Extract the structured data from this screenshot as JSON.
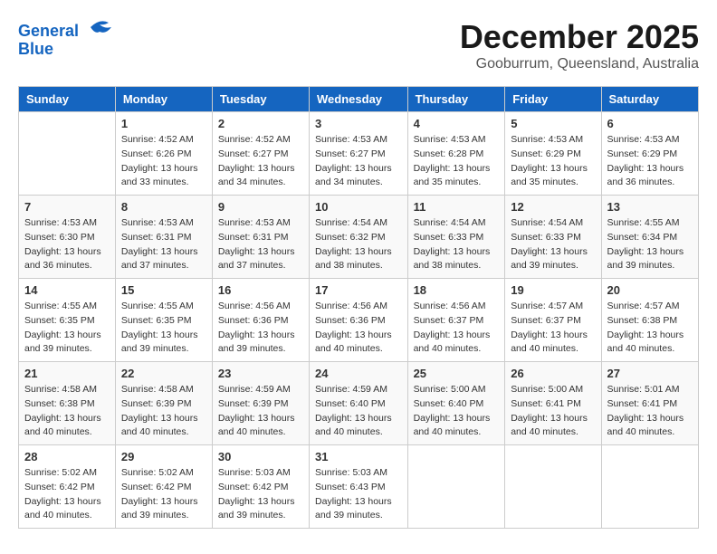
{
  "header": {
    "logo_line1": "General",
    "logo_line2": "Blue",
    "month": "December 2025",
    "location": "Gooburrum, Queensland, Australia"
  },
  "days_of_week": [
    "Sunday",
    "Monday",
    "Tuesday",
    "Wednesday",
    "Thursday",
    "Friday",
    "Saturday"
  ],
  "weeks": [
    [
      {
        "day": "",
        "sunrise": "",
        "sunset": "",
        "daylight": ""
      },
      {
        "day": "1",
        "sunrise": "Sunrise: 4:52 AM",
        "sunset": "Sunset: 6:26 PM",
        "daylight": "Daylight: 13 hours and 33 minutes."
      },
      {
        "day": "2",
        "sunrise": "Sunrise: 4:52 AM",
        "sunset": "Sunset: 6:27 PM",
        "daylight": "Daylight: 13 hours and 34 minutes."
      },
      {
        "day": "3",
        "sunrise": "Sunrise: 4:53 AM",
        "sunset": "Sunset: 6:27 PM",
        "daylight": "Daylight: 13 hours and 34 minutes."
      },
      {
        "day": "4",
        "sunrise": "Sunrise: 4:53 AM",
        "sunset": "Sunset: 6:28 PM",
        "daylight": "Daylight: 13 hours and 35 minutes."
      },
      {
        "day": "5",
        "sunrise": "Sunrise: 4:53 AM",
        "sunset": "Sunset: 6:29 PM",
        "daylight": "Daylight: 13 hours and 35 minutes."
      },
      {
        "day": "6",
        "sunrise": "Sunrise: 4:53 AM",
        "sunset": "Sunset: 6:29 PM",
        "daylight": "Daylight: 13 hours and 36 minutes."
      }
    ],
    [
      {
        "day": "7",
        "sunrise": "Sunrise: 4:53 AM",
        "sunset": "Sunset: 6:30 PM",
        "daylight": "Daylight: 13 hours and 36 minutes."
      },
      {
        "day": "8",
        "sunrise": "Sunrise: 4:53 AM",
        "sunset": "Sunset: 6:31 PM",
        "daylight": "Daylight: 13 hours and 37 minutes."
      },
      {
        "day": "9",
        "sunrise": "Sunrise: 4:53 AM",
        "sunset": "Sunset: 6:31 PM",
        "daylight": "Daylight: 13 hours and 37 minutes."
      },
      {
        "day": "10",
        "sunrise": "Sunrise: 4:54 AM",
        "sunset": "Sunset: 6:32 PM",
        "daylight": "Daylight: 13 hours and 38 minutes."
      },
      {
        "day": "11",
        "sunrise": "Sunrise: 4:54 AM",
        "sunset": "Sunset: 6:33 PM",
        "daylight": "Daylight: 13 hours and 38 minutes."
      },
      {
        "day": "12",
        "sunrise": "Sunrise: 4:54 AM",
        "sunset": "Sunset: 6:33 PM",
        "daylight": "Daylight: 13 hours and 39 minutes."
      },
      {
        "day": "13",
        "sunrise": "Sunrise: 4:55 AM",
        "sunset": "Sunset: 6:34 PM",
        "daylight": "Daylight: 13 hours and 39 minutes."
      }
    ],
    [
      {
        "day": "14",
        "sunrise": "Sunrise: 4:55 AM",
        "sunset": "Sunset: 6:35 PM",
        "daylight": "Daylight: 13 hours and 39 minutes."
      },
      {
        "day": "15",
        "sunrise": "Sunrise: 4:55 AM",
        "sunset": "Sunset: 6:35 PM",
        "daylight": "Daylight: 13 hours and 39 minutes."
      },
      {
        "day": "16",
        "sunrise": "Sunrise: 4:56 AM",
        "sunset": "Sunset: 6:36 PM",
        "daylight": "Daylight: 13 hours and 39 minutes."
      },
      {
        "day": "17",
        "sunrise": "Sunrise: 4:56 AM",
        "sunset": "Sunset: 6:36 PM",
        "daylight": "Daylight: 13 hours and 40 minutes."
      },
      {
        "day": "18",
        "sunrise": "Sunrise: 4:56 AM",
        "sunset": "Sunset: 6:37 PM",
        "daylight": "Daylight: 13 hours and 40 minutes."
      },
      {
        "day": "19",
        "sunrise": "Sunrise: 4:57 AM",
        "sunset": "Sunset: 6:37 PM",
        "daylight": "Daylight: 13 hours and 40 minutes."
      },
      {
        "day": "20",
        "sunrise": "Sunrise: 4:57 AM",
        "sunset": "Sunset: 6:38 PM",
        "daylight": "Daylight: 13 hours and 40 minutes."
      }
    ],
    [
      {
        "day": "21",
        "sunrise": "Sunrise: 4:58 AM",
        "sunset": "Sunset: 6:38 PM",
        "daylight": "Daylight: 13 hours and 40 minutes."
      },
      {
        "day": "22",
        "sunrise": "Sunrise: 4:58 AM",
        "sunset": "Sunset: 6:39 PM",
        "daylight": "Daylight: 13 hours and 40 minutes."
      },
      {
        "day": "23",
        "sunrise": "Sunrise: 4:59 AM",
        "sunset": "Sunset: 6:39 PM",
        "daylight": "Daylight: 13 hours and 40 minutes."
      },
      {
        "day": "24",
        "sunrise": "Sunrise: 4:59 AM",
        "sunset": "Sunset: 6:40 PM",
        "daylight": "Daylight: 13 hours and 40 minutes."
      },
      {
        "day": "25",
        "sunrise": "Sunrise: 5:00 AM",
        "sunset": "Sunset: 6:40 PM",
        "daylight": "Daylight: 13 hours and 40 minutes."
      },
      {
        "day": "26",
        "sunrise": "Sunrise: 5:00 AM",
        "sunset": "Sunset: 6:41 PM",
        "daylight": "Daylight: 13 hours and 40 minutes."
      },
      {
        "day": "27",
        "sunrise": "Sunrise: 5:01 AM",
        "sunset": "Sunset: 6:41 PM",
        "daylight": "Daylight: 13 hours and 40 minutes."
      }
    ],
    [
      {
        "day": "28",
        "sunrise": "Sunrise: 5:02 AM",
        "sunset": "Sunset: 6:42 PM",
        "daylight": "Daylight: 13 hours and 40 minutes."
      },
      {
        "day": "29",
        "sunrise": "Sunrise: 5:02 AM",
        "sunset": "Sunset: 6:42 PM",
        "daylight": "Daylight: 13 hours and 39 minutes."
      },
      {
        "day": "30",
        "sunrise": "Sunrise: 5:03 AM",
        "sunset": "Sunset: 6:42 PM",
        "daylight": "Daylight: 13 hours and 39 minutes."
      },
      {
        "day": "31",
        "sunrise": "Sunrise: 5:03 AM",
        "sunset": "Sunset: 6:43 PM",
        "daylight": "Daylight: 13 hours and 39 minutes."
      },
      {
        "day": "",
        "sunrise": "",
        "sunset": "",
        "daylight": ""
      },
      {
        "day": "",
        "sunrise": "",
        "sunset": "",
        "daylight": ""
      },
      {
        "day": "",
        "sunrise": "",
        "sunset": "",
        "daylight": ""
      }
    ]
  ]
}
